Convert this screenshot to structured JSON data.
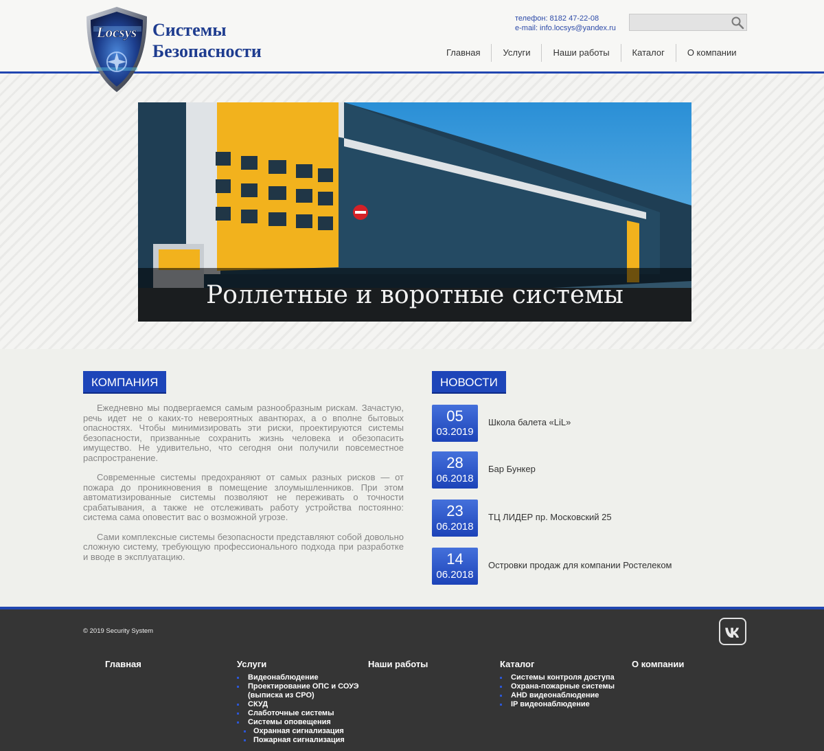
{
  "header": {
    "logo_word": "Locsys",
    "title_line1": "Системы",
    "title_line2": "Безопасности",
    "phone": "телефон: 8182 47-22-08",
    "email": "e-mail: info.locsys@yandex.ru",
    "search_value": "",
    "nav": [
      "Главная",
      "Услуги",
      "Наши работы",
      "Каталог",
      "О компании"
    ]
  },
  "banner": {
    "caption": "Роллетные и воротные системы"
  },
  "company": {
    "heading": "КОМПАНИЯ",
    "paragraphs": [
      "Ежедневно мы подвергаемся самым разнообразным рискам. Зачастую, речь идет не о каких-то невероятных авантюрах, а о вполне бытовых опасностях. Чтобы минимизировать эти риски, проектируются системы безопасности, призванные сохранить жизнь человека и обезопасить имущество. Не удивительно, что сегодня они получили повсеместное распространение.",
      "Современные системы предохраняют от самых разных рисков — от пожара до проникновения в помещение злоумышленников. При этом автоматизированные системы позволяют не переживать о точности срабатывания, а также не отслеживать работу устройства постоянно: система сама оповестит вас о возможной угрозе.",
      "Сами комплексные системы безопасности представляют собой довольно сложную систему, требующую профессионального подхода при разработке и вводе в эксплуатацию."
    ]
  },
  "news": {
    "heading": "НОВОСТИ",
    "items": [
      {
        "day": "05",
        "month_year": "03.2019",
        "title": "Школа балета «LiL»"
      },
      {
        "day": "28",
        "month_year": "06.2018",
        "title": "Бар Бункер"
      },
      {
        "day": "23",
        "month_year": "06.2018",
        "title": "ТЦ ЛИДЕР пр. Московский 25"
      },
      {
        "day": "14",
        "month_year": "06.2018",
        "title": "Островки продаж для компании Ростелеком"
      }
    ]
  },
  "footer": {
    "copyright": "© 2019 Security System",
    "columns": [
      {
        "title": "Главная",
        "items": []
      },
      {
        "title": "Услуги",
        "items": [
          "Видеонаблюдение",
          "Проектирование ОПС и СОУЭ (выписка из СРО)",
          "СКУД",
          "Слаботочные системы",
          "Системы оповещения"
        ],
        "sub_items": [
          "Охранная сигнализация",
          "Пожарная сигнализация"
        ]
      },
      {
        "title": "Наши работы",
        "items": []
      },
      {
        "title": "Каталог",
        "items": [
          "Системы контроля доступа",
          "Охрана-пожарные системы",
          "AHD видеонаблюдение",
          "IP видеонаблюдение"
        ]
      },
      {
        "title": "О компании",
        "items": []
      }
    ]
  },
  "colors": {
    "accent_blue": "#1d45b9",
    "header_line": "#2146b0",
    "footer_bg": "#353535"
  },
  "icons": [
    "shield-logo-icon",
    "search-icon",
    "vk-icon",
    "no-entry-sign-icon"
  ]
}
